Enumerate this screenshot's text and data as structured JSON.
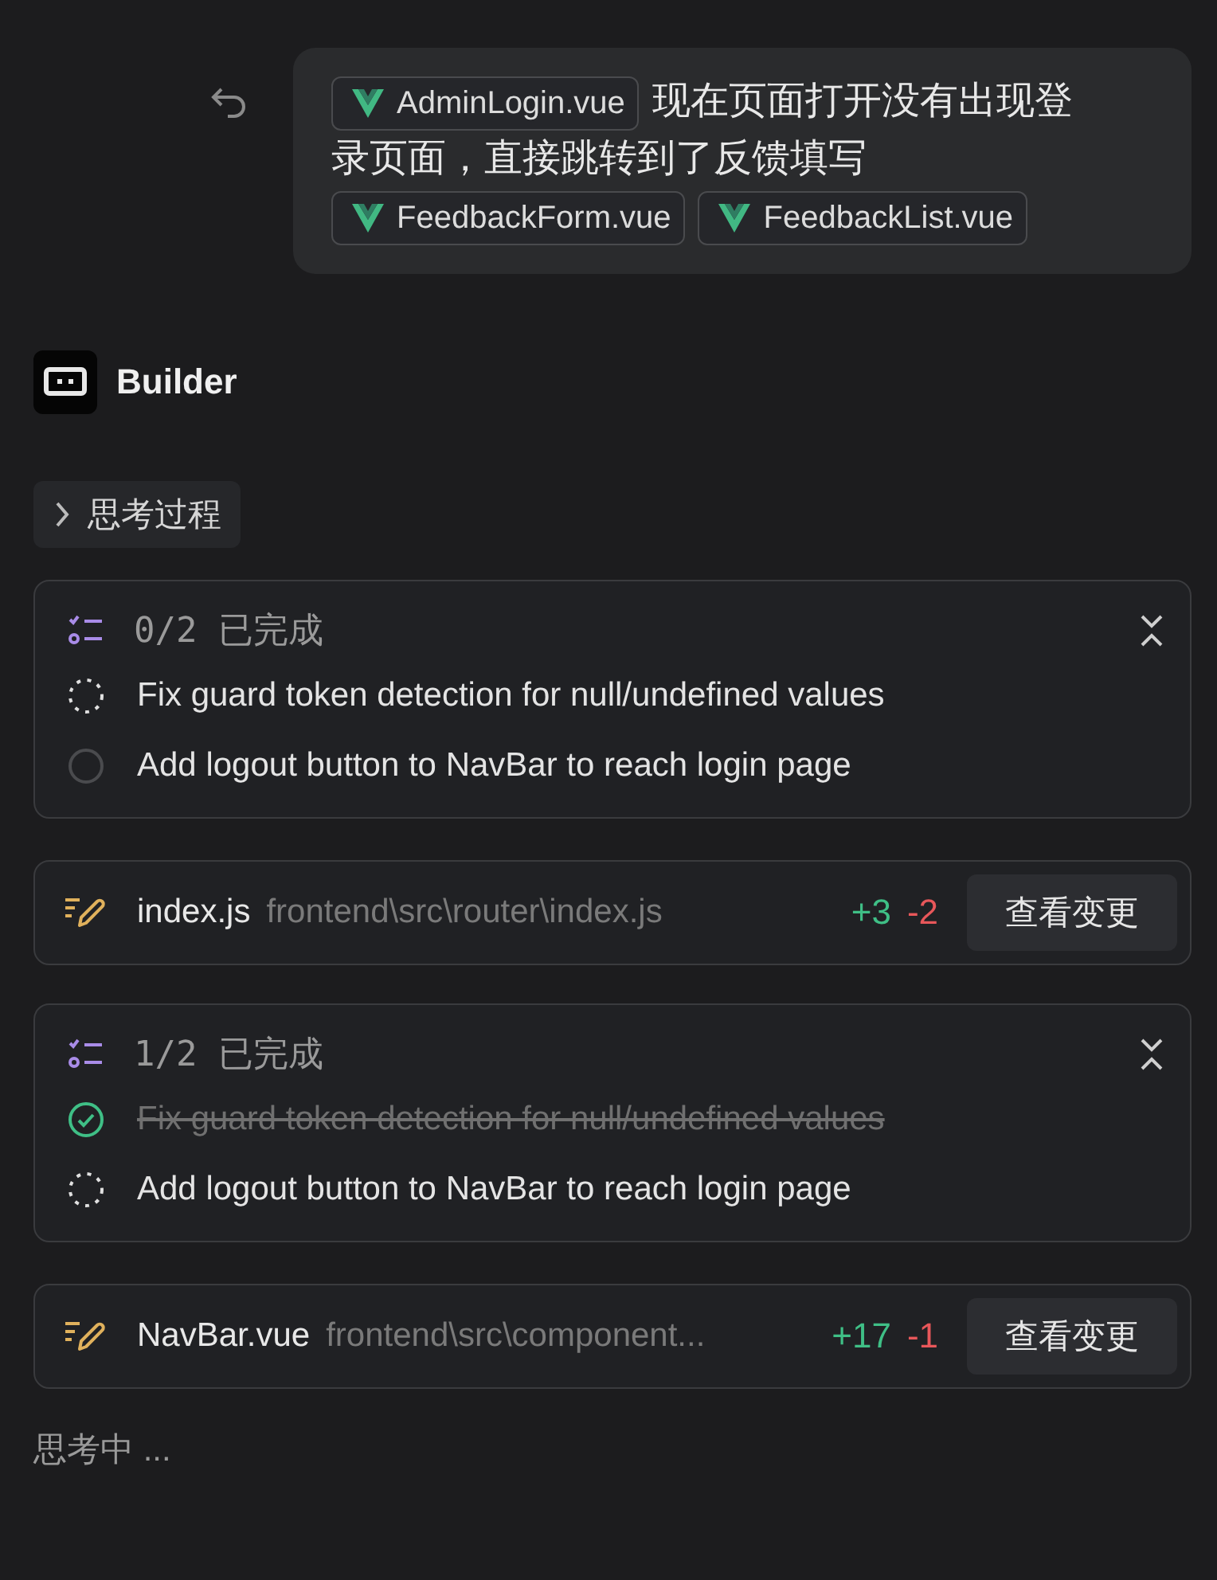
{
  "message": {
    "segments": [
      {
        "kind": "file",
        "text": "AdminLogin.vue"
      },
      {
        "kind": "text",
        "text": "现在页面打开没有出现登"
      },
      {
        "kind": "text",
        "text": "录页面，直接跳转到了反馈填写"
      },
      {
        "kind": "file",
        "text": "FeedbackForm.vue"
      },
      {
        "kind": "file",
        "text": "FeedbackList.vue"
      }
    ]
  },
  "agent": {
    "name": "Builder"
  },
  "thinking_toggle": {
    "label": "思考过程",
    "expanded": false
  },
  "blocks": [
    {
      "kind": "todo",
      "progress": "0/2 已完成",
      "expanded": true,
      "items": [
        {
          "text": "Fix guard token detection for null/undefined values",
          "kind": "in_progress"
        },
        {
          "text": "Add logout button to NavBar to reach login page",
          "kind": "pending"
        }
      ]
    },
    {
      "kind": "file",
      "name": "index.js",
      "path": "frontend\\src\\router\\index.js",
      "added": "+3",
      "removed": "-2",
      "action": "查看变更"
    },
    {
      "kind": "todo",
      "progress": "1/2 已完成",
      "expanded": true,
      "items": [
        {
          "text": "Fix guard token detection for null/undefined values",
          "kind": "done"
        },
        {
          "text": "Add logout button to NavBar to reach login page",
          "kind": "in_progress"
        }
      ]
    },
    {
      "kind": "file",
      "name": "NavBar.vue",
      "path": "frontend\\src\\component...",
      "added": "+17",
      "removed": "-1",
      "action": "查看变更"
    }
  ],
  "status": "思考中 ..."
}
